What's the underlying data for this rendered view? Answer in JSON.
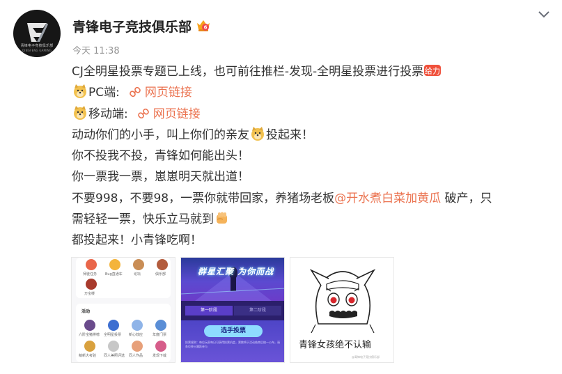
{
  "account": {
    "name": "青锋电子竞技俱乐部",
    "avatar_text_top": "青锋电子竞技俱乐部",
    "avatar_text_bottom": "QINGFENG GAMING",
    "badge_icon": "vip-crown-badge-icon"
  },
  "timestamp": "今天 11:38",
  "menu_icon": "chevron-down-icon",
  "post": {
    "line1_text": "CJ全明星投票专题已上线，也可前往推栏-发现-全明星投票进行投票",
    "line1_badge": "给力",
    "line2_label": "PC端:",
    "line2_link": "网页链接",
    "line3_label": "移动端:",
    "line3_link": "网页链接",
    "line4_before": "动动你们的小手，叫上你们的亲友",
    "line4_after": "投起来！",
    "line5": "你不投我不投，青锋如何能出头！",
    "line6": "你一票我一票，崽崽明天就出道！",
    "line7_before": "不要998，不要98，一票你就带回家，养猪场老板",
    "line7_mention": "@开水煮白菜加黄瓜",
    "line7_after": " 破产，只",
    "line8": "需轻轻一票，快乐立马就到",
    "line9": "都投起来！小青锋吃啊！"
  },
  "thumbs": {
    "t1": {
      "row_labels": [
        "师徒任务",
        "Bug直通车",
        "论坛",
        "俱乐部",
        "万宝楼"
      ],
      "section_title": "活动",
      "grid_labels": [
        "六阶宝猪排榜",
        "全明星投票",
        "新心效应",
        "年度门票",
        "萌新大考验",
        "同人美照评选",
        "同人作品",
        "发现下载"
      ]
    },
    "t2": {
      "hero_title": "群星汇聚 为你而战",
      "tab1": "第一阶段",
      "tab2": "第二阶段",
      "vote_button": "选手投票",
      "small_text": "投票规则：每位玩家每日可获得投票机会，票数将于活动结束后统一公布，请各位侠士踊跃参与"
    },
    "t3": {
      "caption": "青锋女孩绝不认输",
      "watermark": "@青锋电子竞技俱乐部"
    }
  },
  "colors": {
    "link": "#eb7350",
    "text": "#333333",
    "meta": "#939393"
  }
}
